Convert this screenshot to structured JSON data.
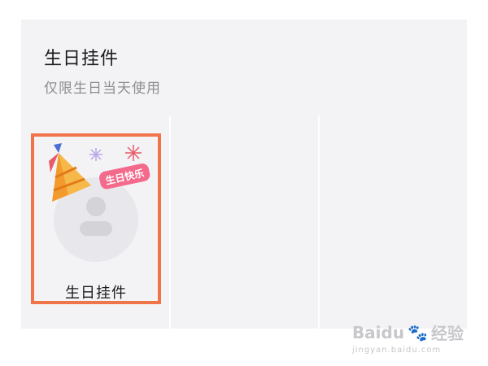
{
  "section": {
    "title": "生日挂件",
    "subtitle": "仅限生日当天使用"
  },
  "items": [
    {
      "label": "生日挂件",
      "badge_text": "生日快乐",
      "selected": true,
      "icon": "birthday-hat-avatar-frame-icon"
    }
  ],
  "watermark": {
    "brand": "Baidu",
    "product": "经验",
    "url": "jingyan.baidu.com"
  },
  "colors": {
    "selection_border": "#f0744a",
    "panel_background": "#f3f3f5"
  }
}
